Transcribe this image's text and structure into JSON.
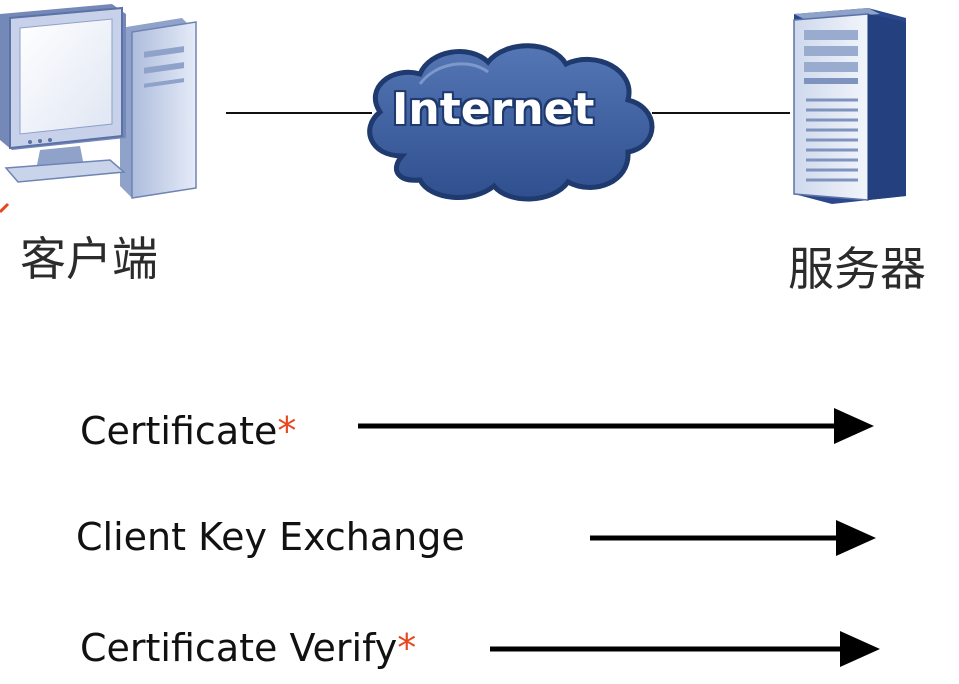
{
  "diagram": {
    "client": {
      "label": "客户端",
      "icon": "desktop-computer-icon"
    },
    "network": {
      "label": "Internet",
      "icon": "cloud-icon",
      "fill": "#3b5c9a",
      "stroke": "#1f3a6e"
    },
    "server": {
      "label": "服务器",
      "icon": "server-tower-icon"
    },
    "messages": [
      {
        "text": "Certificate",
        "marker": "*"
      },
      {
        "text": "Client Key Exchange",
        "marker": ""
      },
      {
        "text": "Certificate Verify",
        "marker": "*"
      }
    ],
    "colors": {
      "marker": "#e8461e",
      "arrow": "#000000",
      "device_body": "#c9d4ea",
      "device_shade": "#7f93bf",
      "device_dark": "#27448a"
    }
  }
}
